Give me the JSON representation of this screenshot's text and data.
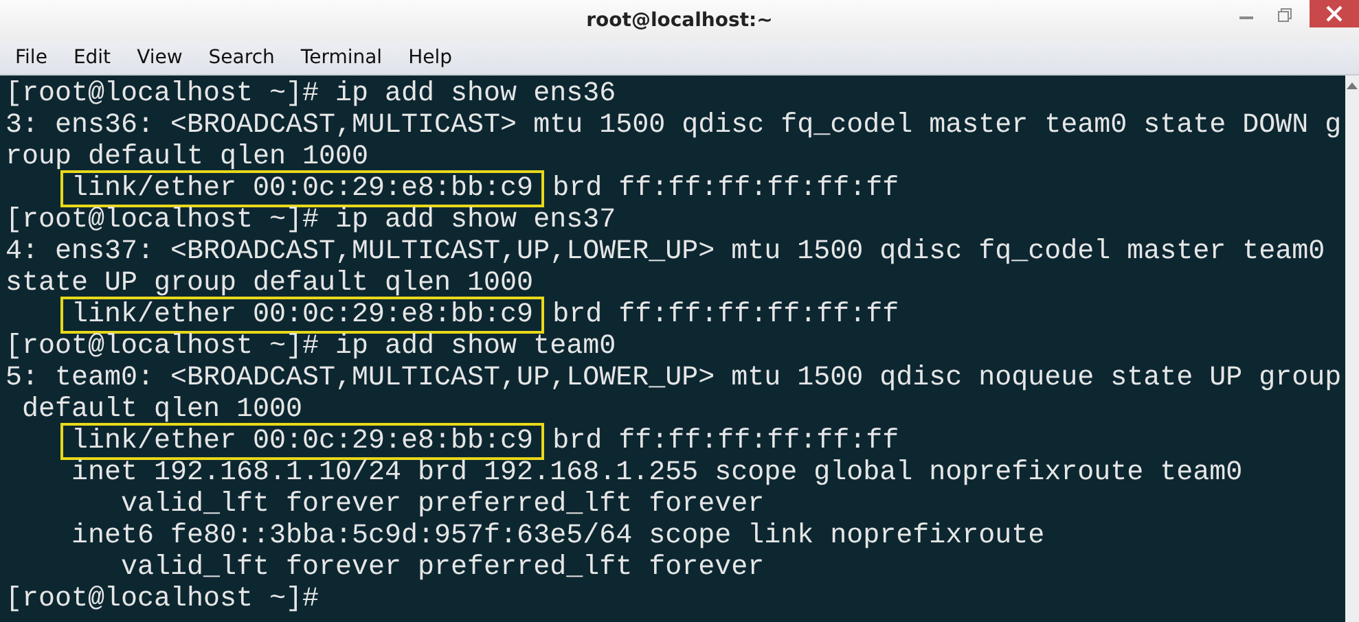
{
  "window": {
    "title": "root@localhost:~"
  },
  "menu": [
    "File",
    "Edit",
    "View",
    "Search",
    "Terminal",
    "Help"
  ],
  "terminal": {
    "lines": [
      {
        "kind": "plain",
        "text": "[root@localhost ~]# ip add show ens36"
      },
      {
        "kind": "plain",
        "text": "3: ens36: <BROADCAST,MULTICAST> mtu 1500 qdisc fq_codel master team0 state DOWN g"
      },
      {
        "kind": "plain",
        "text": "roup default qlen 1000"
      },
      {
        "kind": "highlight",
        "highlight": "link/ether 00:0c:29:e8:bb:c9",
        "rest": "brd ff:ff:ff:ff:ff:ff"
      },
      {
        "kind": "plain",
        "text": "[root@localhost ~]# ip add show ens37"
      },
      {
        "kind": "plain",
        "text": "4: ens37: <BROADCAST,MULTICAST,UP,LOWER_UP> mtu 1500 qdisc fq_codel master team0"
      },
      {
        "kind": "plain",
        "text": "state UP group default qlen 1000"
      },
      {
        "kind": "highlight",
        "highlight": "link/ether 00:0c:29:e8:bb:c9",
        "rest": "brd ff:ff:ff:ff:ff:ff"
      },
      {
        "kind": "plain",
        "text": "[root@localhost ~]# ip add show team0"
      },
      {
        "kind": "plain",
        "text": "5: team0: <BROADCAST,MULTICAST,UP,LOWER_UP> mtu 1500 qdisc noqueue state UP group"
      },
      {
        "kind": "plain",
        "text": " default qlen 1000"
      },
      {
        "kind": "highlight",
        "highlight": "link/ether 00:0c:29:e8:bb:c9",
        "rest": "brd ff:ff:ff:ff:ff:ff"
      },
      {
        "kind": "plain",
        "text": "    inet 192.168.1.10/24 brd 192.168.1.255 scope global noprefixroute team0"
      },
      {
        "kind": "plain",
        "text": "       valid_lft forever preferred_lft forever"
      },
      {
        "kind": "plain",
        "text": "    inet6 fe80::3bba:5c9d:957f:63e5/64 scope link noprefixroute"
      },
      {
        "kind": "plain",
        "text": "       valid_lft forever preferred_lft forever"
      },
      {
        "kind": "plain",
        "text": "[root@localhost ~]#"
      }
    ]
  }
}
